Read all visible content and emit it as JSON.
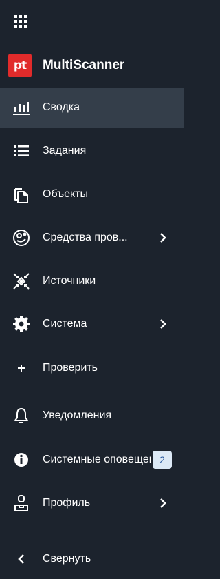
{
  "brand": {
    "logo_text": "pt",
    "app_name": "MultiScanner",
    "logo_color": "#e12b2b"
  },
  "colors": {
    "background": "#1c232d",
    "active_background": "#343e4a",
    "badge_background": "#dce9f6",
    "badge_text": "#2a5aa0"
  },
  "nav": {
    "items": [
      {
        "label": "Сводка",
        "icon": "bar-chart-icon",
        "active": true
      },
      {
        "label": "Задания",
        "icon": "list-icon"
      },
      {
        "label": "Объекты",
        "icon": "files-icon"
      },
      {
        "label": "Средства пров...",
        "icon": "scan-tools-icon",
        "has_submenu": true
      },
      {
        "label": "Источники",
        "icon": "sources-icon"
      },
      {
        "label": "Система",
        "icon": "gear-icon",
        "has_submenu": true
      },
      {
        "label": "Проверить",
        "icon": "plus-icon"
      },
      {
        "label": "Уведомления",
        "icon": "bell-icon"
      },
      {
        "label": "Системные оповещения",
        "icon": "info-icon",
        "badge": "2"
      },
      {
        "label": "Профиль",
        "icon": "user-icon",
        "has_submenu": true
      }
    ],
    "collapse_label": "Свернуть"
  }
}
